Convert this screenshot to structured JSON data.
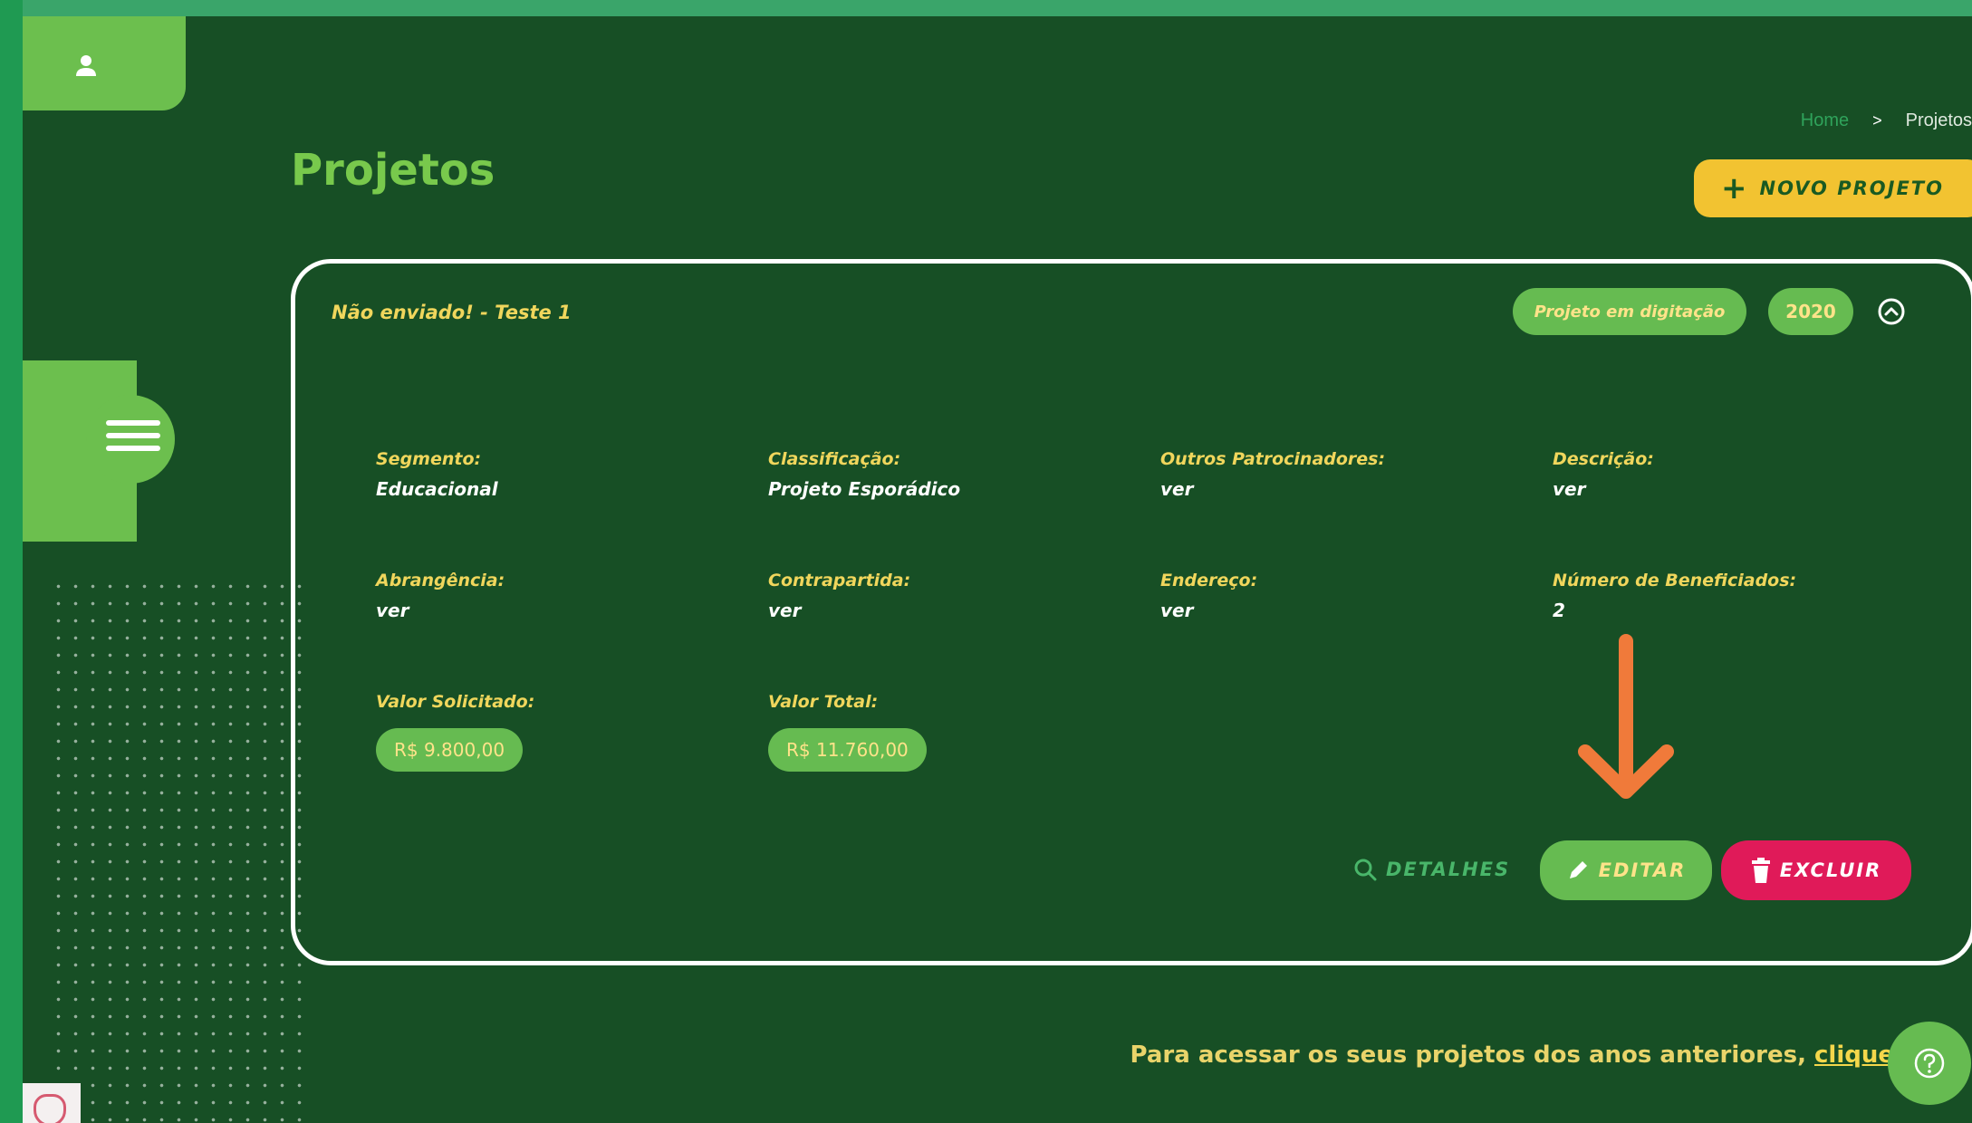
{
  "breadcrumb": {
    "home": "Home",
    "separator": ">",
    "current": "Projetos"
  },
  "page": {
    "title": "Projetos"
  },
  "toolbar": {
    "new_project_plus": "+",
    "new_project_label": "NOVO PROJETO"
  },
  "project": {
    "title": "Não enviado! - Teste 1",
    "status": "Projeto em digitação",
    "year": "2020",
    "fields": {
      "segmento": {
        "label": "Segmento:",
        "value": "Educacional"
      },
      "classificacao": {
        "label": "Classificação:",
        "value": "Projeto Esporádico"
      },
      "outros": {
        "label": "Outros Patrocinadores:",
        "value": "ver"
      },
      "descricao": {
        "label": "Descrição:",
        "value": "ver"
      },
      "abrangencia": {
        "label": "Abrangência:",
        "value": "ver"
      },
      "contrapartida": {
        "label": "Contrapartida:",
        "value": "ver"
      },
      "endereco": {
        "label": "Endereço:",
        "value": "ver"
      },
      "beneficiados": {
        "label": "Número de Beneficiados:",
        "value": "2"
      },
      "valor_solicitado": {
        "label": "Valor Solicitado:",
        "value": "R$ 9.800,00"
      },
      "valor_total": {
        "label": "Valor Total:",
        "value": "R$ 11.760,00"
      }
    },
    "actions": {
      "detalhes": "DETALHES",
      "editar": "EDITAR",
      "excluir": "EXCLUIR"
    }
  },
  "footer": {
    "text": "Para acessar os seus projetos dos anos anteriores, ",
    "link": "clique"
  },
  "colors": {
    "background": "#174f25",
    "accent_green": "#66bb51",
    "accent_yellow": "#f2c331",
    "danger": "#e01a59",
    "annotation_arrow": "#f07a3a"
  }
}
